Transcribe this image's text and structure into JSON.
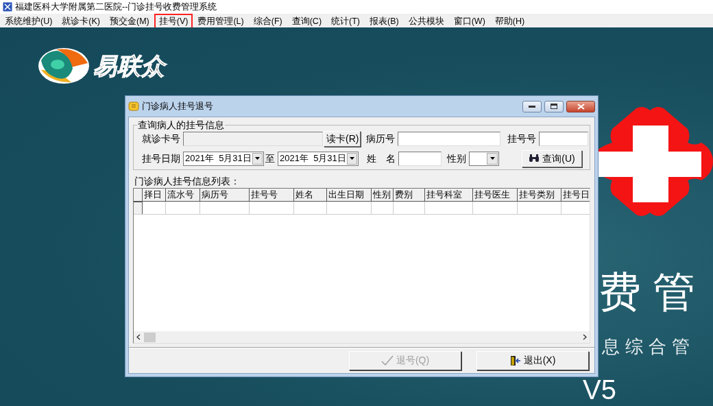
{
  "app_title": "福建医科大学附属第二医院--门诊挂号收费管理系统",
  "menu": [
    {
      "label": "系统维护(U)",
      "highlighted": false
    },
    {
      "label": "就诊卡(K)",
      "highlighted": false
    },
    {
      "label": "预交金(M)",
      "highlighted": false
    },
    {
      "label": "挂号(V)",
      "highlighted": true
    },
    {
      "label": "费用管理(L)",
      "highlighted": false
    },
    {
      "label": "综合(F)",
      "highlighted": false
    },
    {
      "label": "查询(C)",
      "highlighted": false
    },
    {
      "label": "统计(T)",
      "highlighted": false
    },
    {
      "label": "报表(B)",
      "highlighted": false
    },
    {
      "label": "公共模块",
      "highlighted": false
    },
    {
      "label": "窗口(W)",
      "highlighted": false
    },
    {
      "label": "帮助(H)",
      "highlighted": false
    }
  ],
  "background": {
    "logo_text": "易联众",
    "banner_texts": [
      "费 管",
      "息综合管",
      "V5"
    ]
  },
  "dialog": {
    "title": "门诊病人挂号退号",
    "query_group": {
      "title": "查询病人的挂号信息",
      "rows": [
        [
          {
            "kind": "input",
            "label": "就诊卡号",
            "disabled": true
          },
          {
            "kind": "button",
            "label": "读卡(R)"
          },
          {
            "kind": "input",
            "label": "病历号",
            "disabled": false
          },
          {
            "kind": "input",
            "label": "挂号号",
            "disabled": false
          }
        ],
        [
          {
            "kind": "date",
            "label": "挂号日期",
            "value": "2021年  5月31日"
          },
          {
            "kind": "date",
            "label": "至",
            "value": "2021年  5月31日"
          },
          {
            "kind": "input",
            "label": "姓　名",
            "disabled": false
          },
          {
            "kind": "select",
            "label": "性别"
          },
          {
            "kind": "search_button",
            "label": "查询(U)"
          }
        ]
      ]
    },
    "list_title": "门诊病人挂号信息列表：",
    "table": {
      "columns": [
        "择日",
        "流水号",
        "病历号",
        "挂号号",
        "姓名",
        "出生日期",
        "性别",
        "费别",
        "挂号科室",
        "挂号医生",
        "挂号类别",
        "挂号日"
      ]
    },
    "buttons": [
      {
        "label": "退号(Q)",
        "kind": "confirm",
        "disabled": true
      },
      {
        "label": "退出(X)",
        "kind": "exit",
        "disabled": false
      }
    ]
  }
}
